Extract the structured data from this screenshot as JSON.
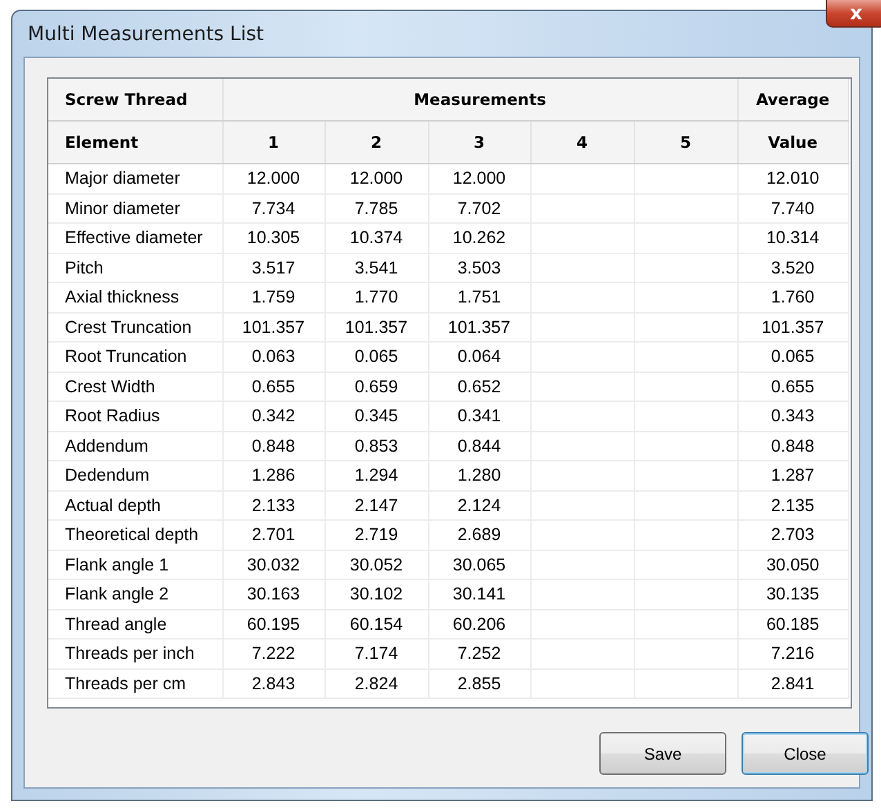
{
  "window": {
    "title": "Multi Measurements List",
    "close_glyph": "x"
  },
  "table": {
    "group_headers": [
      {
        "label": "Screw Thread"
      },
      {
        "label": "Measurements"
      },
      {
        "label": "Average"
      }
    ],
    "columns": [
      "Element",
      "1",
      "2",
      "3",
      "4",
      "5",
      "Value"
    ],
    "rows": [
      [
        "Major diameter",
        "12.000",
        "12.000",
        "12.000",
        "",
        "",
        "12.010"
      ],
      [
        "Minor diameter",
        "7.734",
        "7.785",
        "7.702",
        "",
        "",
        "7.740"
      ],
      [
        "Effective diameter",
        "10.305",
        "10.374",
        "10.262",
        "",
        "",
        "10.314"
      ],
      [
        "Pitch",
        "3.517",
        "3.541",
        "3.503",
        "",
        "",
        "3.520"
      ],
      [
        "Axial thickness",
        "1.759",
        "1.770",
        "1.751",
        "",
        "",
        "1.760"
      ],
      [
        "Crest Truncation",
        "101.357",
        "101.357",
        "101.357",
        "",
        "",
        "101.357"
      ],
      [
        "Root Truncation",
        "0.063",
        "0.065",
        "0.064",
        "",
        "",
        "0.065"
      ],
      [
        "Crest Width",
        "0.655",
        "0.659",
        "0.652",
        "",
        "",
        "0.655"
      ],
      [
        "Root Radius",
        "0.342",
        "0.345",
        "0.341",
        "",
        "",
        "0.343"
      ],
      [
        "Addendum",
        "0.848",
        "0.853",
        "0.844",
        "",
        "",
        "0.848"
      ],
      [
        "Dedendum",
        "1.286",
        "1.294",
        "1.280",
        "",
        "",
        "1.287"
      ],
      [
        "Actual depth",
        "2.133",
        "2.147",
        "2.124",
        "",
        "",
        "2.135"
      ],
      [
        "Theoretical depth",
        "2.701",
        "2.719",
        "2.689",
        "",
        "",
        "2.703"
      ],
      [
        "Flank angle 1",
        "30.032",
        "30.052",
        "30.065",
        "",
        "",
        "30.050"
      ],
      [
        "Flank angle 2",
        "30.163",
        "30.102",
        "30.141",
        "",
        "",
        "30.135"
      ],
      [
        "Thread angle",
        "60.195",
        "60.154",
        "60.206",
        "",
        "",
        "60.185"
      ],
      [
        "Threads per inch",
        "7.222",
        "7.174",
        "7.252",
        "",
        "",
        "7.216"
      ],
      [
        "Threads per cm",
        "2.843",
        "2.824",
        "2.855",
        "",
        "",
        "2.841"
      ]
    ]
  },
  "buttons": [
    {
      "label": "Save",
      "focused": false
    },
    {
      "label": "Close",
      "focused": true
    }
  ]
}
